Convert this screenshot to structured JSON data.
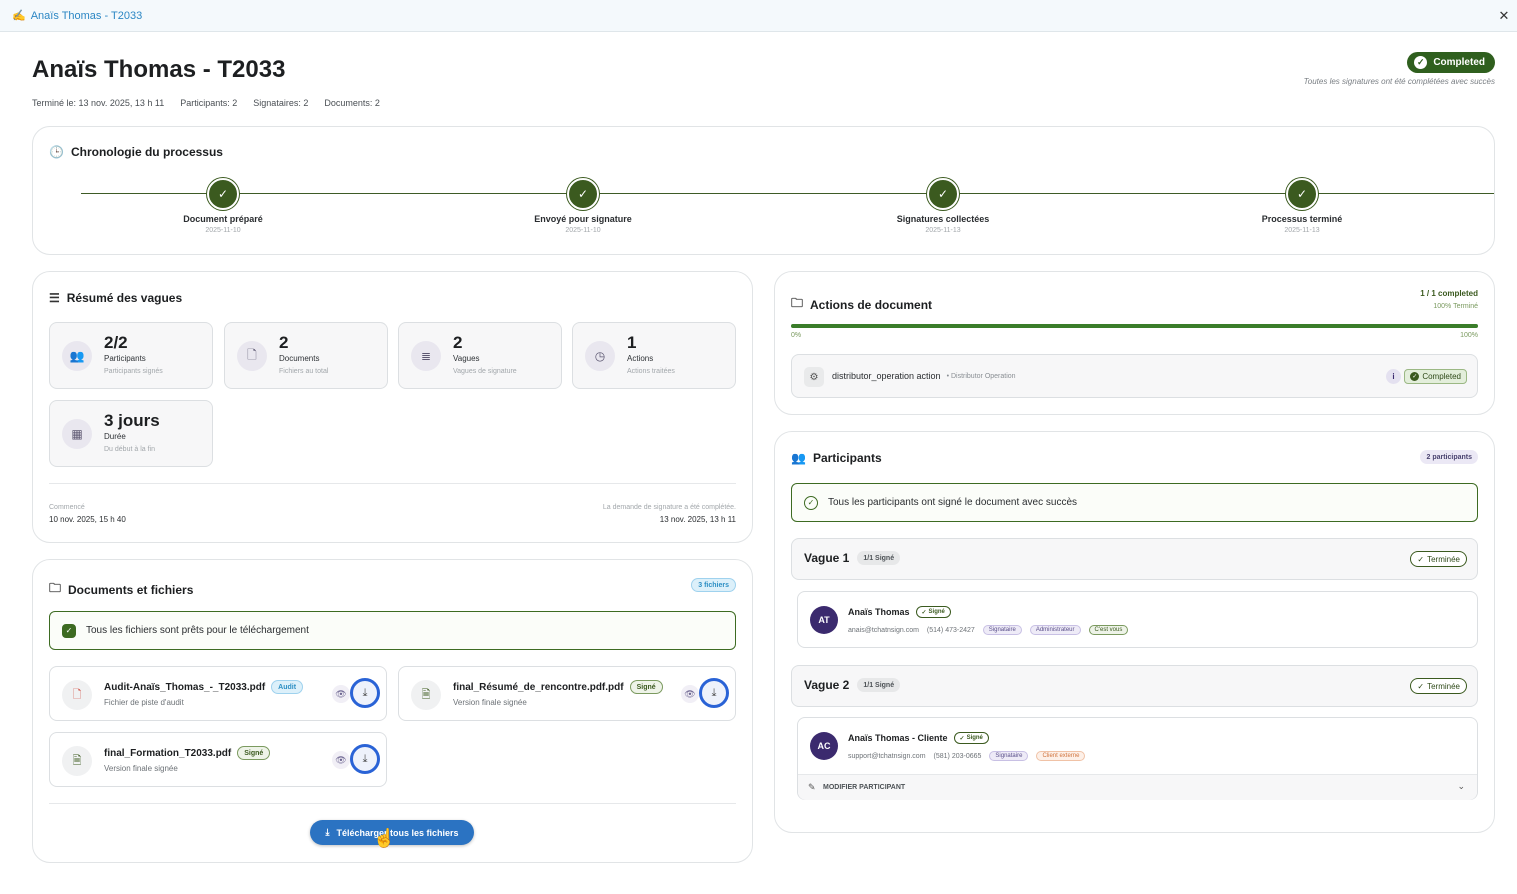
{
  "window": {
    "title": "Anaïs Thomas - T2033",
    "close": "✕"
  },
  "header": {
    "title": "Anaïs Thomas - T2033",
    "meta": {
      "finished": "Terminé le: 13 nov. 2025, 13 h 11",
      "participants": "Participants: 2",
      "signers": "Signataires: 2",
      "documents": "Documents: 2"
    },
    "status": "Completed",
    "status_note": "Toutes les signatures ont été complétées avec succès"
  },
  "timeline": {
    "title": "Chronologie du processus",
    "steps": [
      {
        "label": "Document préparé",
        "date": "2025-11-10"
      },
      {
        "label": "Envoyé pour signature",
        "date": "2025-11-10"
      },
      {
        "label": "Signatures collectées",
        "date": "2025-11-13"
      },
      {
        "label": "Processus terminé",
        "date": "2025-11-13"
      }
    ]
  },
  "summary": {
    "title": "Résumé des vagues",
    "stats": [
      {
        "icon": "users-icon",
        "value": "2/2",
        "label": "Participants",
        "sub": "Participants signés"
      },
      {
        "icon": "document-icon",
        "value": "2",
        "label": "Documents",
        "sub": "Fichiers au total"
      },
      {
        "icon": "layers-icon",
        "value": "2",
        "label": "Vagues",
        "sub": "Vagues de signature"
      },
      {
        "icon": "clock-icon",
        "value": "1",
        "label": "Actions",
        "sub": "Actions traitées"
      },
      {
        "icon": "calendar-icon",
        "value": "3 jours",
        "label": "Durée",
        "sub": "Du début à la fin"
      }
    ],
    "started_label": "Commencé",
    "started_value": "10 nov. 2025, 15 h 40",
    "completed_label": "La demande de signature a été complétée.",
    "completed_value": "13 nov. 2025, 13 h 11"
  },
  "documents": {
    "title": "Documents et fichiers",
    "count_badge": "3 fichiers",
    "ready_banner": "Tous les fichiers sont prêts pour le téléchargement",
    "files": [
      {
        "name": "Audit-Anaïs_Thomas_-_T2033.pdf",
        "badge": "Audit",
        "sub": "Fichier de piste d'audit"
      },
      {
        "name": "final_Résumé_de_rencontre.pdf.pdf",
        "badge": "Signé",
        "sub": "Version finale signée"
      },
      {
        "name": "final_Formation_T2033.pdf",
        "badge": "Signé",
        "sub": "Version finale signée"
      }
    ],
    "download_all": "Télécharger tous les fichiers"
  },
  "actions": {
    "title": "Actions de document",
    "completed_count": "1 / 1 completed",
    "percent_label": "100% Terminé",
    "progress": 1.0,
    "min_label": "0%",
    "max_label": "100%",
    "row": {
      "name": "distributor_operation action",
      "type": "• Distributor Operation",
      "status": "Completed"
    }
  },
  "participants": {
    "title": "Participants",
    "count_badge": "2 participants",
    "success_banner": "Tous les participants ont signé le document avec succès",
    "waves": [
      {
        "title": "Vague 1",
        "signed_badge": "1/1 Signé",
        "status": "Terminée",
        "person": {
          "initials": "AT",
          "name": "Anaïs Thomas",
          "signed": "Signé",
          "email": "anais@tchatnsign.com",
          "phone": "(514) 473-2427",
          "tags": [
            "Signataire",
            "Administrateur",
            "C'est vous"
          ]
        }
      },
      {
        "title": "Vague 2",
        "signed_badge": "1/1 Signé",
        "status": "Terminée",
        "person": {
          "initials": "AC",
          "name": "Anaïs Thomas - Cliente",
          "signed": "Signé",
          "email": "support@tchatnsign.com",
          "phone": "(581) 203-0665",
          "tags": [
            "Signataire",
            "Client externe"
          ]
        },
        "modify": "MODIFIER PARTICIPANT"
      }
    ]
  },
  "colors": {
    "accent_green": "#3b5a1f",
    "primary_blue": "#2b73c2",
    "highlight_ring": "#2a63d6"
  }
}
